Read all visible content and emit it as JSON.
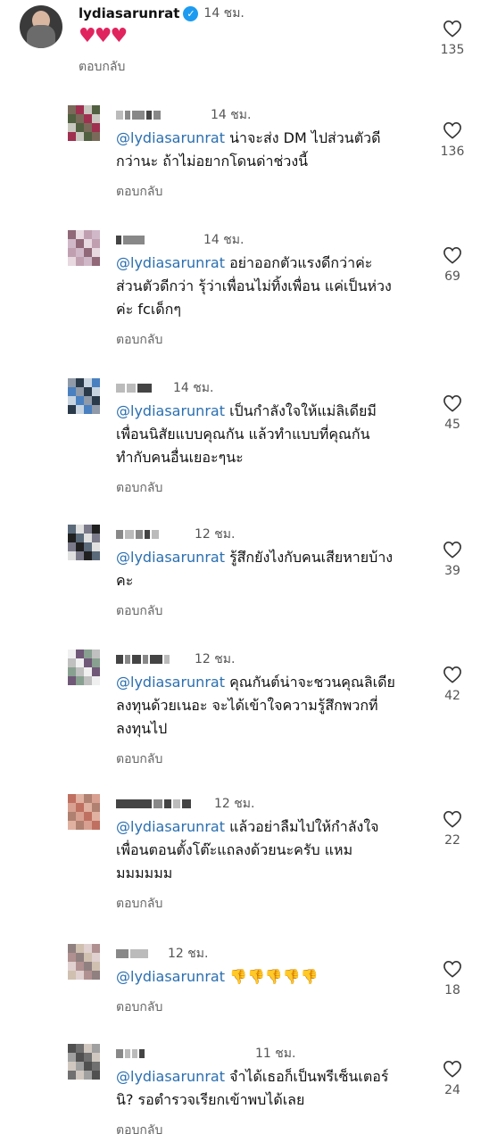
{
  "main_comment": {
    "username": "lydiasarunrat",
    "time": "14 ชม.",
    "text": "♥♥♥",
    "reply": "ตอบกลับ",
    "likes": "135"
  },
  "replies": [
    {
      "time": "14 ชม.",
      "mention": "@lydiasarunrat",
      "line1": "น่าจะส่ง DM ไปส่วนตัวดี",
      "line2": "กว่านะ ถ้าไม่อยากโดนด่าช่วงนี้",
      "line3": "",
      "reply": "ตอบกลับ",
      "likes": "136"
    },
    {
      "time": "14 ชม.",
      "mention": "@lydiasarunrat",
      "line1": "อย่าออกตัวแรงดีกว่าค่ะ",
      "line2": "ส่วนตัวดีกว่า รุ้ว่าเพื่อนไม่ทิ้งเพื่อน แค่เป็นห่วง",
      "line3": "ค่ะ fcเด็กๆ",
      "reply": "ตอบกลับ",
      "likes": "69"
    },
    {
      "time": "14 ชม.",
      "mention": "@lydiasarunrat",
      "line1": "เป็นกำลังใจให้แม่ลิเดียมี",
      "line2": "เพื่อนนิสัยแบบคุณกัน แล้วทำแบบที่คุณกัน",
      "line3": "ทำกับคนอื่นเยอะๆนะ",
      "reply": "ตอบกลับ",
      "likes": "45"
    },
    {
      "time": "12 ชม.",
      "mention": "@lydiasarunrat",
      "line1": "รู้สึกยังไงกับคนเสียหายบ้าง",
      "line2": "คะ",
      "line3": "",
      "reply": "ตอบกลับ",
      "likes": "39"
    },
    {
      "time": "12 ชม.",
      "mention": "@lydiasarunrat",
      "line1": "คุณกันต์น่าจะชวนคุณลิเดีย",
      "line2": "ลงทุนด้วยเนอะ จะได้เข้าใจความรู้สึกพวกที่",
      "line3": "ลงทุนไป",
      "reply": "ตอบกลับ",
      "likes": "42"
    },
    {
      "time": "12 ชม.",
      "mention": "@lydiasarunrat",
      "line1": "แล้วอย่าลืมไปให้กำลังใจ",
      "line2": "เพื่อนตอนตั้งโต๊ะแถลงด้วยนะครับ แหม",
      "line3": "มมมมมม",
      "reply": "ตอบกลับ",
      "likes": "22"
    },
    {
      "time": "12 ชม.",
      "mention": "@lydiasarunrat",
      "line1": "👎👎👎👎👎",
      "line2": "",
      "line3": "",
      "reply": "ตอบกลับ",
      "likes": "18"
    },
    {
      "time": "11 ชม.",
      "mention": "@lydiasarunrat",
      "line1": "จำได้เธอก็เป็นพรีเซ็นเตอร์",
      "line2": "นิ? รอตำรวจเรียกเข้าพบได้เลย",
      "line3": "",
      "reply": "ตอบกลับ",
      "likes": "24"
    }
  ],
  "colors": {
    "mention": "#2a6fb0",
    "heart": "#e0245e",
    "verified": "#1d9bf0"
  },
  "icons": {
    "like": "heart-outline-icon",
    "verified": "verified-badge-icon"
  }
}
